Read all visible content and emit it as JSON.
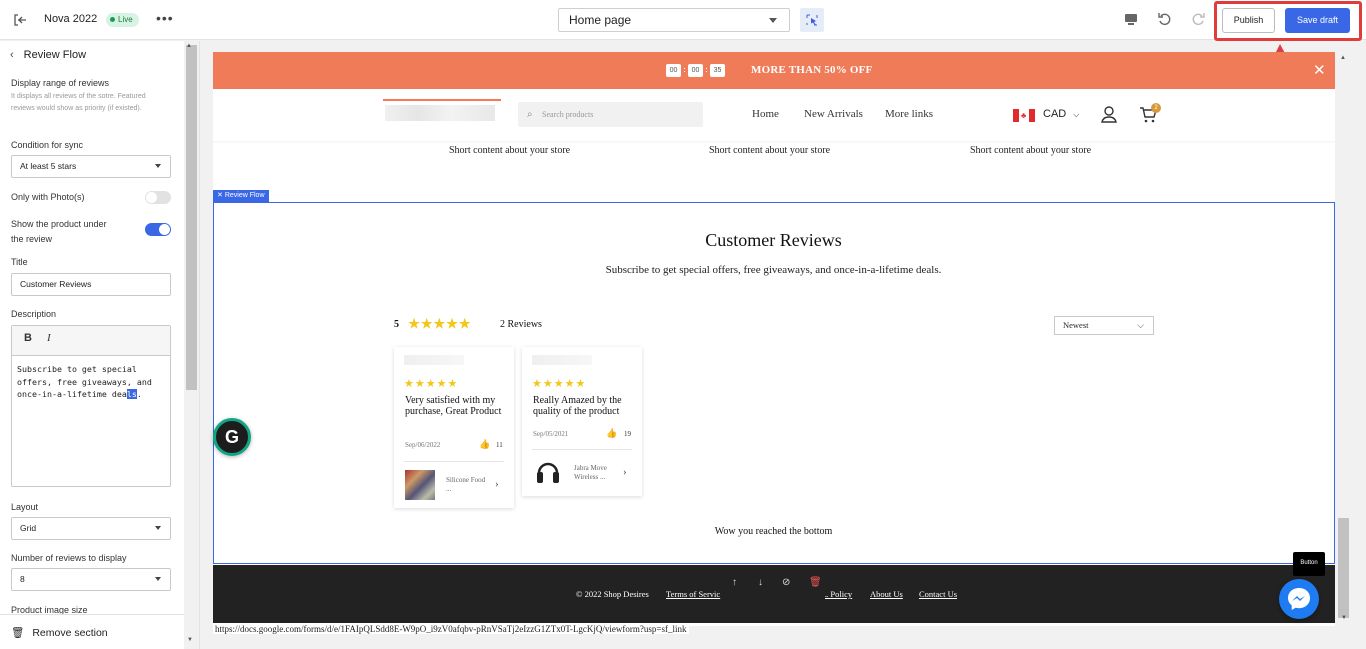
{
  "topbar": {
    "store_name": "Nova 2022",
    "status": "Live",
    "page_select": "Home page",
    "publish_label": "Publish",
    "save_label": "Save draft",
    "accent_color": "#3a67e6",
    "highlight_color": "#e23b3b",
    "icons": [
      "exit-icon",
      "more-icon",
      "selection-tool-icon",
      "desktop-icon",
      "undo-icon",
      "redo-icon"
    ]
  },
  "sidebar": {
    "title": "Review Flow",
    "range_label": "Display range of reviews",
    "range_hint": "It displays all reviews of the sotre. Featured reviews would show as priority (if existed).",
    "condition_label": "Condition for sync",
    "condition_value": "At least 5 stars",
    "photos_label": "Only with Photo(s)",
    "photos_on": false,
    "show_product_label": "Show the product under the review",
    "show_product_on": true,
    "title_label": "Title",
    "title_value": "Customer Reviews",
    "description_label": "Description",
    "bold_label": "B",
    "italic_label": "I",
    "description_before": "Subscribe to get special offers, free giveaways, and once-in-a-lifetime dea",
    "description_selected": "ls",
    "description_after": ".",
    "layout_label": "Layout",
    "layout_value": "Grid",
    "num_reviews_label": "Number of reviews to display",
    "num_reviews_value": "8",
    "product_image_label": "Product image size",
    "remove_label": "Remove section"
  },
  "store": {
    "timer": [
      "00",
      "00",
      "35"
    ],
    "announcement": "MORE THAN 50% OFF",
    "announcement_color": "#ef7b58",
    "search_placeholder": "Search products",
    "nav": [
      "Home",
      "New Arrivals",
      "More links"
    ],
    "currency": "CAD",
    "cart_count": "2",
    "short_content": [
      "Short content about your store",
      "Short content about your store",
      "Short content about your store"
    ],
    "section_tag": "Review Flow",
    "reviews_title": "Customer Reviews",
    "reviews_subtitle": "Subscribe to get special offers, free giveaways, and once-in-a-lifetime deals.",
    "rating_value": "5",
    "review_count": "2 Reviews",
    "sort_value": "Newest",
    "reviews": [
      {
        "rating": 5,
        "text": "Very satisfied with my purchase, Great Product",
        "date": "Sep/06/2022",
        "likes": "11",
        "product": "Silicone Food ..."
      },
      {
        "rating": 5,
        "text": "Really Amazed by the quality of the product",
        "date": "Sep/05/2021",
        "likes": "19",
        "product": "Jabra Move Wireless ..."
      }
    ],
    "bottom_message": "Wow you reached the bottom",
    "footer_links": [
      "© 2022 Shop Desires",
      "Terms of Servic",
      "s Policy",
      "About Us",
      "Contact Us"
    ],
    "button_tooltip": "Button",
    "status_url": "https://docs.google.com/forms/d/e/1FAIpQLSdd8E-W9pO_i9zV0afqbv-pRnVSaTj2eIzzG1ZTx0T-LgcKjQ/viewform?usp=sf_link"
  }
}
